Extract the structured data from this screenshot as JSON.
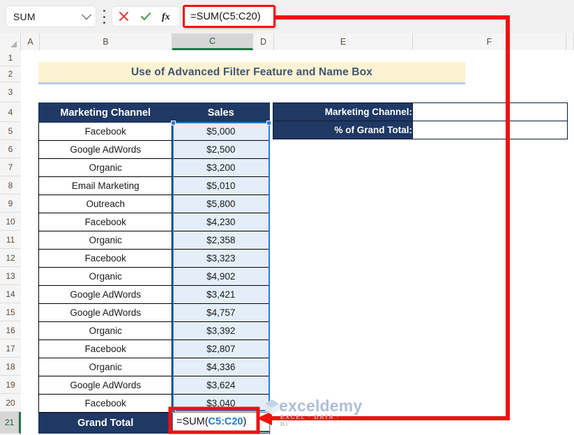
{
  "formula_bar": {
    "name_box_value": "SUM",
    "name_box_icon": "chevron-down-icon",
    "kebab_icon": "more-options-icon",
    "cancel_icon": "cancel-x-icon",
    "enter_icon": "enter-check-icon",
    "function_icon": "fx-insert-function-icon",
    "formula_value": "=SUM(C5:C20)"
  },
  "columns": [
    {
      "label": "A",
      "active": false
    },
    {
      "label": "B",
      "active": false
    },
    {
      "label": "C",
      "active": true
    },
    {
      "label": "D",
      "active": false
    },
    {
      "label": "E",
      "active": false
    },
    {
      "label": "F",
      "active": false
    }
  ],
  "rows": [
    {
      "label": "1",
      "active": false
    },
    {
      "label": "2",
      "active": false
    },
    {
      "label": "3",
      "active": false
    },
    {
      "label": "4",
      "active": false
    },
    {
      "label": "5",
      "active": false
    },
    {
      "label": "6",
      "active": false
    },
    {
      "label": "7",
      "active": false
    },
    {
      "label": "8",
      "active": false
    },
    {
      "label": "9",
      "active": false
    },
    {
      "label": "10",
      "active": false
    },
    {
      "label": "11",
      "active": false
    },
    {
      "label": "12",
      "active": false
    },
    {
      "label": "13",
      "active": false
    },
    {
      "label": "14",
      "active": false
    },
    {
      "label": "15",
      "active": false
    },
    {
      "label": "16",
      "active": false
    },
    {
      "label": "17",
      "active": false
    },
    {
      "label": "18",
      "active": false
    },
    {
      "label": "19",
      "active": false
    },
    {
      "label": "20",
      "active": false
    },
    {
      "label": "21",
      "active": true
    }
  ],
  "sheet": {
    "title": "Use of Advanced Filter Feature and Name Box",
    "table": {
      "headers": [
        "Marketing Channel",
        "Sales"
      ],
      "rows": [
        {
          "channel": "Facebook",
          "sales": "$5,000"
        },
        {
          "channel": "Google AdWords",
          "sales": "$2,500"
        },
        {
          "channel": "Organic",
          "sales": "$3,200"
        },
        {
          "channel": "Email Marketing",
          "sales": "$5,010"
        },
        {
          "channel": "Outreach",
          "sales": "$5,800"
        },
        {
          "channel": "Facebook",
          "sales": "$4,230"
        },
        {
          "channel": "Organic",
          "sales": "$2,358"
        },
        {
          "channel": "Facebook",
          "sales": "$3,323"
        },
        {
          "channel": "Organic",
          "sales": "$4,902"
        },
        {
          "channel": "Google AdWords",
          "sales": "$3,421"
        },
        {
          "channel": "Google AdWords",
          "sales": "$4,757"
        },
        {
          "channel": "Organic",
          "sales": "$3,392"
        },
        {
          "channel": "Facebook",
          "sales": "$2,807"
        },
        {
          "channel": "Organic",
          "sales": "$4,336"
        },
        {
          "channel": "Google AdWords",
          "sales": "$3,624"
        },
        {
          "channel": "Facebook",
          "sales": "$3,040"
        }
      ],
      "total_label": "Grand Total",
      "total_formula_prefix": "=SUM(",
      "total_formula_ref": "C5:C20",
      "total_formula_suffix": ")"
    },
    "criteria_panel": [
      {
        "label": "Marketing Channel:",
        "value": ""
      },
      {
        "label": "% of Grand Total:",
        "value": ""
      }
    ]
  },
  "watermark": {
    "text": "exceldemy",
    "subtitle": "EXCEL · DATA · BI",
    "logo_icon": "exceldemy-logo-icon"
  },
  "annotation": {
    "color": "#ee1111",
    "shape": "callout-arrow-from-formula-bar-to-cell-c21"
  },
  "colors": {
    "header_navy": "#1f3864",
    "banner_cream": "#fdf2d2",
    "banner_underline": "#b6cbe3",
    "selection_blue": "#2d7bd4",
    "selection_fill": "#e3eef9",
    "excel_green": "#217346",
    "annotation_red": "#ee1111",
    "reference_blue": "#1f7ad4"
  }
}
